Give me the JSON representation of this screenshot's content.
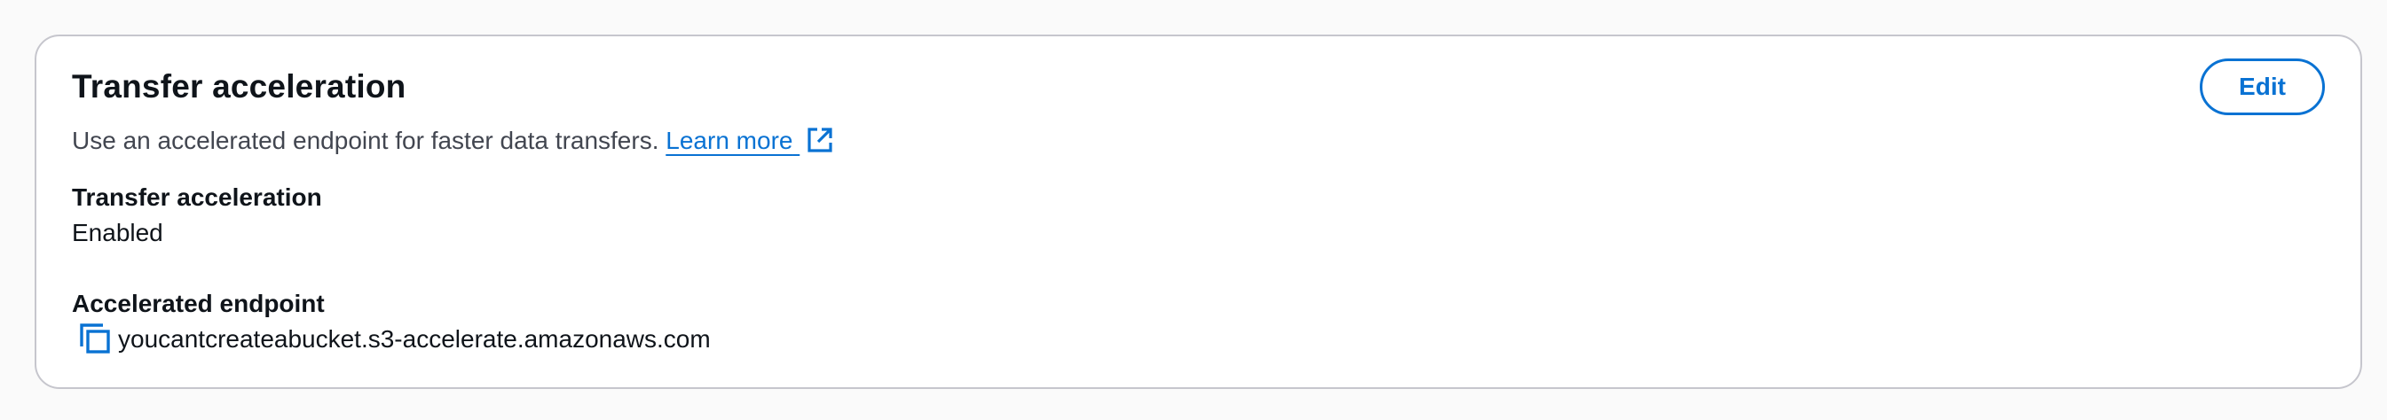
{
  "panel": {
    "title": "Transfer acceleration",
    "description": "Use an accelerated endpoint for faster data transfers.",
    "learn_more_label": "Learn more",
    "edit_label": "Edit"
  },
  "fields": {
    "transfer_acceleration": {
      "label": "Transfer acceleration",
      "value": "Enabled"
    },
    "accelerated_endpoint": {
      "label": "Accelerated endpoint",
      "value": "youcantcreateabucket.s3-accelerate.amazonaws.com"
    }
  },
  "icons": {
    "learn_more": "external-link-icon",
    "endpoint": "copy-icon"
  },
  "colors": {
    "accent": "#0972d3",
    "text": "#0f141a",
    "secondary_text": "#424650",
    "border": "#c6c6cd",
    "background": "#fafafa"
  }
}
